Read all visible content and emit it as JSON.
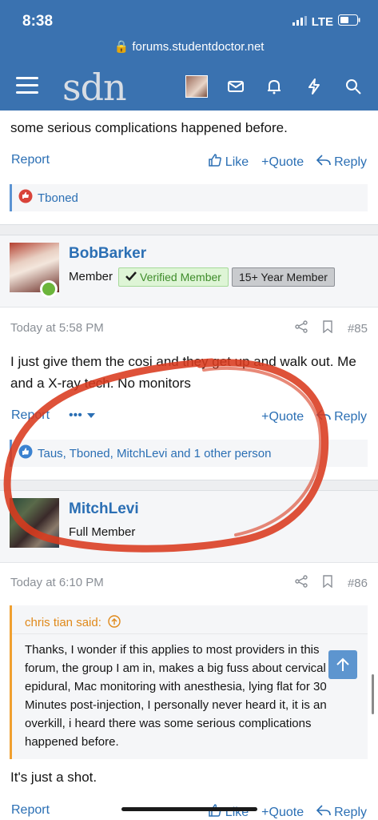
{
  "status_bar": {
    "time": "8:38",
    "network": "LTE"
  },
  "browser": {
    "url": "forums.studentdoctor.net"
  },
  "header": {
    "logo": "sdn"
  },
  "top_post": {
    "text_tail": "some serious complications happened before.",
    "report": "Report",
    "like": "Like",
    "quote": "+Quote",
    "reply": "Reply",
    "reactions": "Tboned"
  },
  "post_85": {
    "username": "BobBarker",
    "title": "Member",
    "badge_verified": "Verified Member",
    "badge_years": "15+ Year Member",
    "date": "Today at 5:58 PM",
    "number": "#85",
    "text": "I just give them the cosi and they get up and walk out. Me and a X-ray tech. No monitors",
    "report": "Report",
    "more": "•••",
    "quote": "+Quote",
    "reply": "Reply",
    "reactions": "Taus, Tboned, MitchLevi and 1 other person"
  },
  "post_86": {
    "username": "MitchLevi",
    "title": "Full Member",
    "date": "Today at 6:10 PM",
    "number": "#86",
    "quote_author": "chris tian said:",
    "quote_text": "Thanks, I wonder if this applies to most providers in this forum, the group I am in, makes a big fuss about cervical epidural, Mac monitoring with anesthesia, lying flat for 30 Minutes post-injection, I personally never heard it, it is an overkill, i heard there was some serious complications happened before.",
    "text": "It's just a shot.",
    "report": "Report",
    "like": "Like",
    "quote": "+Quote",
    "reply": "Reply"
  },
  "colors": {
    "header": "#3a72b0",
    "link": "#2b6fb4",
    "annotation": "#d93a1e",
    "quote_accent": "#f0a030"
  },
  "icons": [
    "hamburger-icon",
    "mail-icon",
    "bell-icon",
    "bolt-icon",
    "search-icon",
    "thumbs-up-icon",
    "reply-icon",
    "share-icon",
    "bookmark-icon",
    "arrow-up-icon"
  ]
}
